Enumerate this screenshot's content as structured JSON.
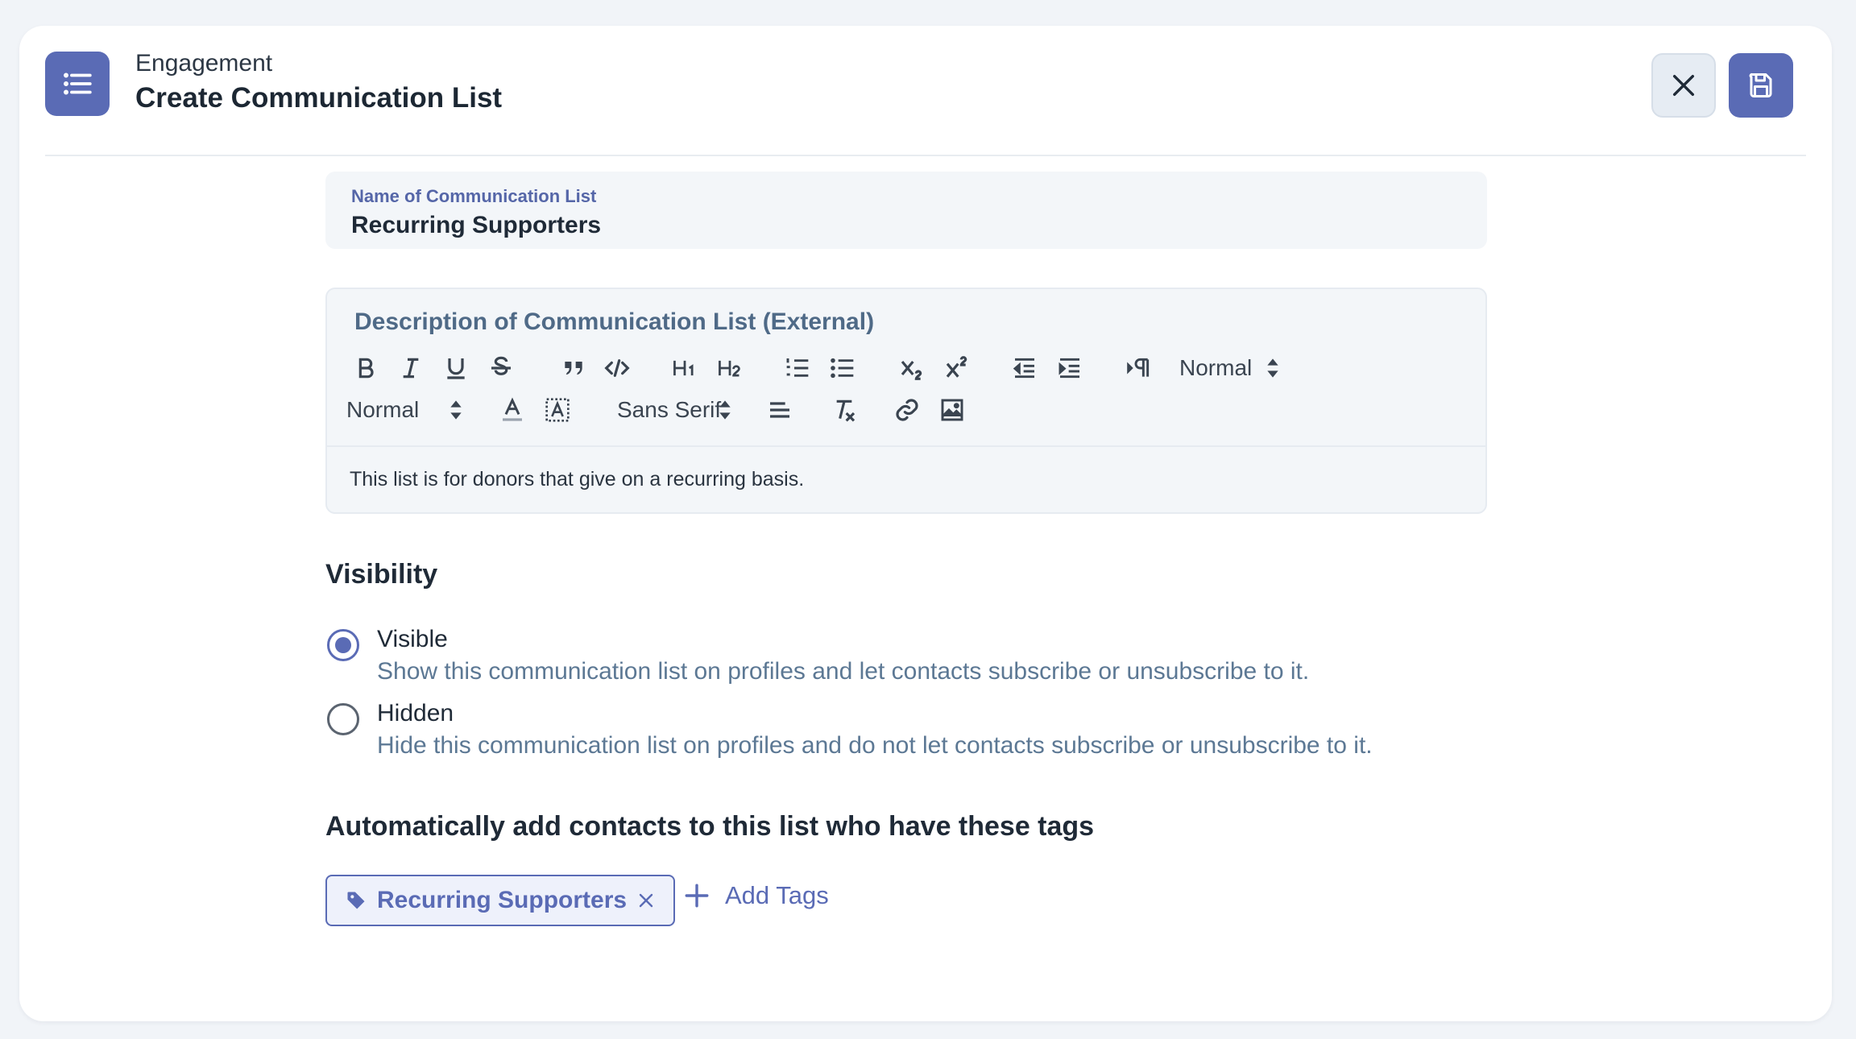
{
  "header": {
    "breadcrumb": "Engagement",
    "title": "Create Communication List",
    "app_icon": "list-icon",
    "close_icon": "close-icon",
    "save_icon": "save-icon"
  },
  "name_field": {
    "label": "Name of Communication List",
    "value": "Recurring Supporters"
  },
  "description": {
    "label": "Description of Communication List (External)",
    "body": "This list is for donors that give on a recurring basis.",
    "toolbar": {
      "header_select": "Normal",
      "size_select": "Normal",
      "font_select": "Sans Serif",
      "buttons": [
        "bold",
        "italic",
        "underline",
        "strike",
        "blockquote",
        "code-block",
        "h1",
        "h2",
        "ordered-list",
        "bullet-list",
        "subscript",
        "superscript",
        "outdent",
        "indent",
        "rtl",
        "color",
        "background",
        "align",
        "clean",
        "link",
        "image"
      ]
    }
  },
  "visibility": {
    "title": "Visibility",
    "options": [
      {
        "label": "Visible",
        "help": "Show this communication list on profiles and let contacts subscribe or unsubscribe to it.",
        "checked": true
      },
      {
        "label": "Hidden",
        "help": "Hide this communication list on profiles and do not let contacts subscribe or unsubscribe to it.",
        "checked": false
      }
    ]
  },
  "tags": {
    "title": "Automatically add contacts to this list who have these tags",
    "items": [
      {
        "label": "Recurring Supporters"
      }
    ],
    "add_label": "Add Tags"
  },
  "colors": {
    "accent": "#5a6bb5",
    "background": "#f1f4f8",
    "field_bg": "#f3f6f9",
    "help_text": "#5c7894"
  }
}
